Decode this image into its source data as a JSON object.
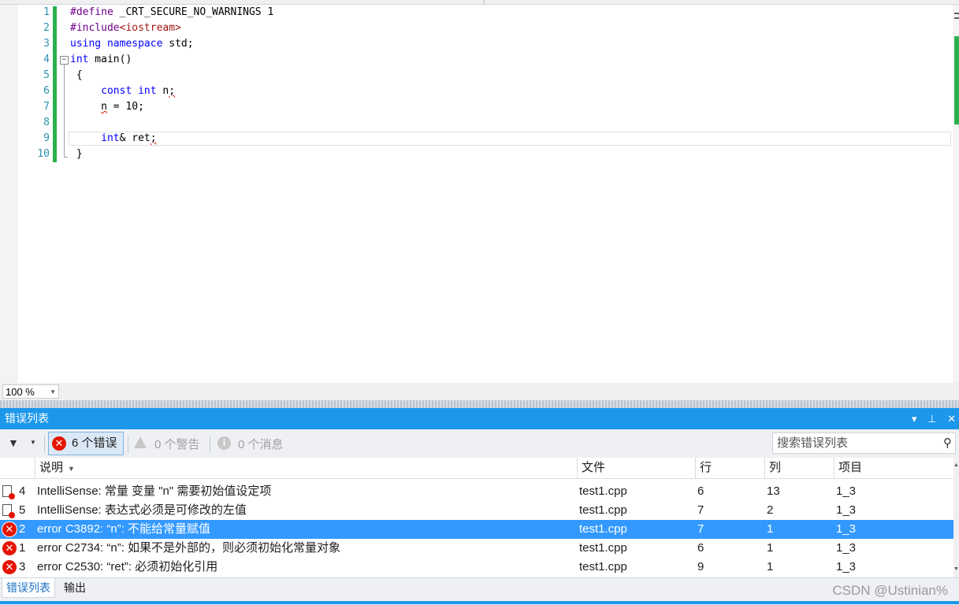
{
  "editor": {
    "lines": [
      {
        "num": "1",
        "tokens": [
          {
            "t": "#define",
            "c": "pp"
          },
          {
            "t": " _CRT_SECURE_NO_WARNINGS 1",
            "c": ""
          }
        ]
      },
      {
        "num": "2",
        "tokens": [
          {
            "t": "#include",
            "c": "pp"
          },
          {
            "t": "<iostream>",
            "c": "str"
          }
        ]
      },
      {
        "num": "3",
        "tokens": [
          {
            "t": "using",
            "c": "kw"
          },
          {
            "t": " ",
            "c": ""
          },
          {
            "t": "namespace",
            "c": "kw"
          },
          {
            "t": " std;",
            "c": ""
          }
        ]
      },
      {
        "num": "4",
        "tokens": [
          {
            "t": "int",
            "c": "kw"
          },
          {
            "t": " main()",
            "c": ""
          }
        ]
      },
      {
        "num": "5",
        "tokens": [
          {
            "t": " {",
            "c": ""
          }
        ]
      },
      {
        "num": "6",
        "tokens": [
          {
            "t": "     ",
            "c": ""
          },
          {
            "t": "const",
            "c": "kw"
          },
          {
            "t": " ",
            "c": ""
          },
          {
            "t": "int",
            "c": "kw"
          },
          {
            "t": " n",
            "c": ""
          },
          {
            "t": ";",
            "c": "squiggle"
          }
        ]
      },
      {
        "num": "7",
        "tokens": [
          {
            "t": "     ",
            "c": ""
          },
          {
            "t": "n",
            "c": "squiggle"
          },
          {
            "t": " = 10;",
            "c": ""
          }
        ]
      },
      {
        "num": "8",
        "tokens": []
      },
      {
        "num": "9",
        "tokens": [
          {
            "t": "     ",
            "c": ""
          },
          {
            "t": "int",
            "c": "kw"
          },
          {
            "t": "& ret",
            "c": ""
          },
          {
            "t": ";",
            "c": "squiggle"
          }
        ]
      },
      {
        "num": "10",
        "tokens": [
          {
            "t": " }",
            "c": ""
          }
        ]
      }
    ]
  },
  "zoom": {
    "value": "100 %"
  },
  "panel": {
    "title": "错误列表",
    "errors_label": "6 个错误",
    "warnings_label": "0 个警告",
    "messages_label": "0 个消息",
    "search_placeholder": "搜索错误列表",
    "columns": {
      "desc": "说明",
      "file": "文件",
      "line": "行",
      "col": "列",
      "project": "项目"
    },
    "rows": [
      {
        "icon": "intellisense",
        "num": "4",
        "desc": "IntelliSense:  常量 变量 \"n\" 需要初始值设定项",
        "file": "test1.cpp",
        "line": "6",
        "col": "13",
        "project": "1_3",
        "selected": false
      },
      {
        "icon": "intellisense",
        "num": "5",
        "desc": "IntelliSense:  表达式必须是可修改的左值",
        "file": "test1.cpp",
        "line": "7",
        "col": "2",
        "project": "1_3",
        "selected": false
      },
      {
        "icon": "error",
        "num": "2",
        "desc": "error C3892: “n”: 不能给常量赋值",
        "file": "test1.cpp",
        "line": "7",
        "col": "1",
        "project": "1_3",
        "selected": true
      },
      {
        "icon": "error",
        "num": "1",
        "desc": "error C2734: “n”: 如果不是外部的，则必须初始化常量对象",
        "file": "test1.cpp",
        "line": "6",
        "col": "1",
        "project": "1_3",
        "selected": false
      },
      {
        "icon": "error",
        "num": "3",
        "desc": "error C2530: “ret”: 必须初始化引用",
        "file": "test1.cpp",
        "line": "9",
        "col": "1",
        "project": "1_3",
        "selected": false
      }
    ]
  },
  "tabs": {
    "errors": "错误列表",
    "output": "输出"
  },
  "watermark": "CSDN @Ustinian%",
  "colors": {
    "accent": "#1c97ea",
    "selection": "#3399ff",
    "error": "#e51400",
    "change_bar": "#29b14c"
  }
}
